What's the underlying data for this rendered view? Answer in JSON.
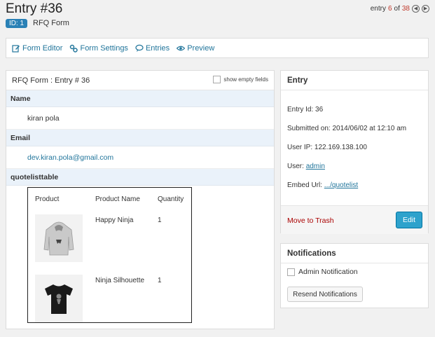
{
  "header": {
    "title": "Entry #36",
    "id_badge": "ID: 1",
    "form_name": "RFQ Form",
    "nav_prefix": "entry",
    "nav_current": "6",
    "nav_of": "of",
    "nav_total": "38"
  },
  "toolbar": {
    "items": [
      {
        "label": "Form Editor",
        "icon": "edit-icon"
      },
      {
        "label": "Form Settings",
        "icon": "settings-icon"
      },
      {
        "label": "Entries",
        "icon": "comment-icon"
      },
      {
        "label": "Preview",
        "icon": "eye-icon"
      }
    ]
  },
  "main": {
    "title": "RFQ Form : Entry # 36",
    "show_empty_label": "show empty fields",
    "fields": [
      {
        "label": "Name",
        "value": "kiran pola"
      },
      {
        "label": "Email",
        "value": "dev.kiran.pola@gmail.com"
      },
      {
        "label": "quotelisttable"
      }
    ],
    "quote_table": {
      "headers": [
        "Product",
        "Product Name",
        "Quantity"
      ],
      "rows": [
        {
          "name": "Happy Ninja",
          "quantity": "1",
          "image": "hoodie-image"
        },
        {
          "name": "Ninja Silhouette",
          "quantity": "1",
          "image": "tshirt-image"
        }
      ]
    }
  },
  "sidebar": {
    "entry_title": "Entry",
    "entry_id": "Entry Id: 36",
    "submitted": "Submitted on: 2014/06/02 at 12:10 am",
    "user_ip": "User IP: 122.169.138.100",
    "user_label": "User:",
    "user_value": "admin",
    "embed_label": "Embed Url:",
    "embed_value": ".../quotelist",
    "trash_label": "Move to Trash",
    "edit_label": "Edit",
    "notifications_title": "Notifications",
    "admin_notification_label": "Admin Notification",
    "resend_label": "Resend Notifications"
  },
  "colors": {
    "accent": "#21759b",
    "button": "#2ea2cc",
    "badge": "#2a81b6",
    "trash": "#aa0000",
    "field_label_bg": "#eaf2fa"
  }
}
